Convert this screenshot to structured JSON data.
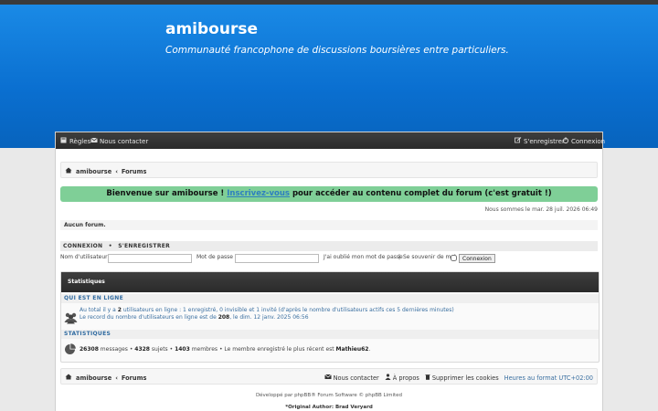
{
  "site": {
    "title": "amibourse",
    "description": "Communauté francophone de discussions boursières entre particuliers."
  },
  "navbar": {
    "rules": "Règles",
    "contact": "Nous contacter",
    "register": "S'enregistrer",
    "login": "Connexion"
  },
  "breadcrumb": {
    "home": "amibourse",
    "sep": "‹",
    "forums": "Forums"
  },
  "welcome": {
    "prefix": "Bienvenue sur amibourse !",
    "link": "Inscrivez-vous",
    "suffix": "pour accéder au contenu complet du forum (c'est gratuit !)"
  },
  "datetime": "Nous sommes le mar. 28 juil. 2026 06:49",
  "no_forum": "Aucun forum.",
  "login_form": {
    "heading_login": "CONNEXION",
    "heading_sep": "•",
    "heading_register": "S'ENREGISTRER",
    "username_label": "Nom d'utilisateur :",
    "password_label": "Mot de passe :",
    "forgot": "J'ai oublié mon mot de passe",
    "pipe": "|",
    "remember": "Se souvenir de moi",
    "submit": "Connexion"
  },
  "stats": {
    "title": "Statistiques",
    "online_heading": "QUI EST EN LIGNE",
    "online_line1_a": "Au total il y a",
    "online_count": "2",
    "online_line1_b": "utilisateurs en ligne : 1 enregistré, 0 invisible et 1 invité (d'après le nombre d'utilisateurs actifs ces 5 dernières minutes)",
    "online_line2_a": "Le record du nombre d'utilisateurs en ligne est de",
    "record_count": "208",
    "online_line2_b": ", le dim. 12 janv. 2025 06:56",
    "stats_heading": "STATISTIQUES",
    "messages_count": "26308",
    "messages_label": "messages",
    "topics_count": "4328",
    "topics_label": "sujets",
    "members_count": "1403",
    "members_label": "membres",
    "newest_label": "Le membre enregistré le plus récent est",
    "newest_member": "Mathieu62",
    "bullet": "•",
    "dot": "."
  },
  "footer_crumb": {
    "contact": "Nous contacter",
    "team": "À propos",
    "delete_cookies": "Supprimer les cookies",
    "timezone": "Heures au format UTC+02:00"
  },
  "footer": {
    "powered": "Développé par phpBB® Forum Software © phpBB Limited",
    "author": "*Original Author: Brad Veryard"
  },
  "colors": {
    "banner": "#0a6fd0",
    "welcome_bg": "#7fcf97",
    "navbar": "#333333"
  }
}
